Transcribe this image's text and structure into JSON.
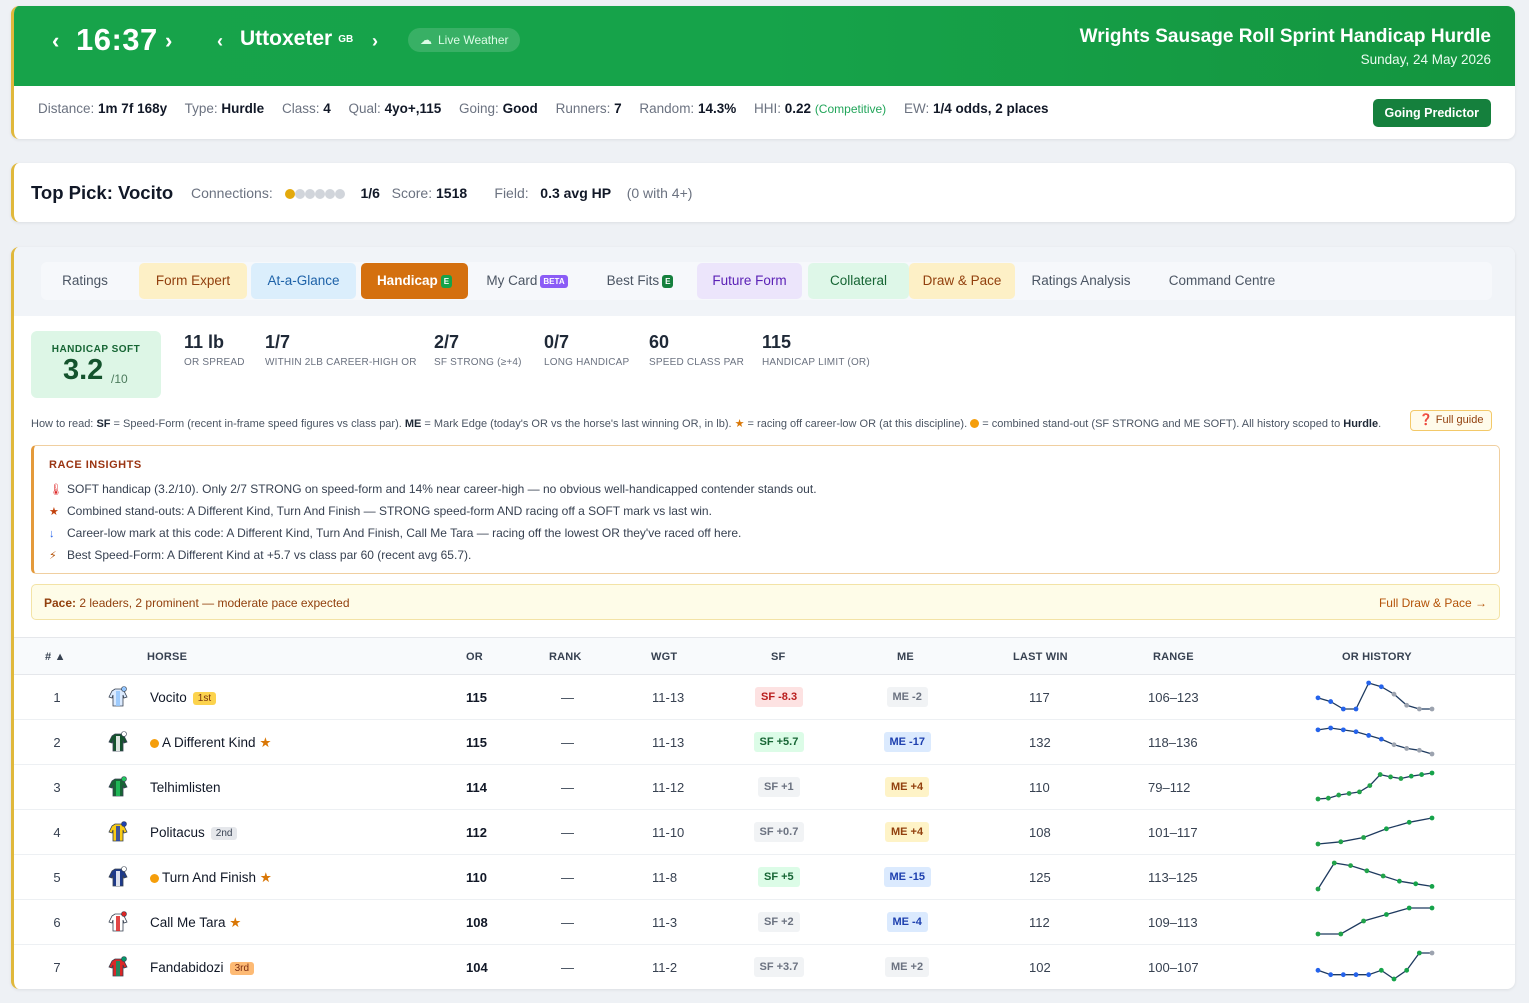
{
  "header": {
    "time": "16:37",
    "course": "Uttoxeter",
    "country": "GB",
    "live_weather": "Live Weather",
    "race_name": "Wrights Sausage Roll Sprint Handicap Hurdle",
    "date": "Sunday, 24 May 2026",
    "going_predictor": "Going Predictor",
    "facts": [
      {
        "label": "Distance:",
        "value": "1m 7f 168y"
      },
      {
        "label": "Type:",
        "value": "Hurdle"
      },
      {
        "label": "Class:",
        "value": "4"
      },
      {
        "label": "Qual:",
        "value": "4yo+,115"
      },
      {
        "label": "Going:",
        "value": "Good"
      },
      {
        "label": "Runners:",
        "value": "7"
      },
      {
        "label": "Random:",
        "value": "14.3%"
      },
      {
        "label": "HHI:",
        "value": "0.22",
        "note": "(Competitive)"
      },
      {
        "label": "EW:",
        "value": "1/4 odds, 2 places"
      }
    ]
  },
  "top_pick": {
    "title": "Top Pick: Vocito",
    "connections_label": "Connections:",
    "connections_filled": 1,
    "connections_total": 6,
    "connections_value": "1/6",
    "score_label": "Score:",
    "score_value": "1518",
    "field_label": "Field:",
    "field_value": "0.3 avg HP",
    "field_note": "(0 with 4+)"
  },
  "tabs": [
    {
      "label": "Ratings",
      "badge": "",
      "active": false,
      "bg": "transparent",
      "fg": "#4b5563"
    },
    {
      "label": "Form Expert",
      "badge": "",
      "active": false,
      "bg": "#fdf0c6",
      "fg": "#92400e"
    },
    {
      "label": "At-a-Glance",
      "badge": "",
      "active": false,
      "bg": "#dbeefc",
      "fg": "#1e62a8"
    },
    {
      "label": "Handicap",
      "badge": "E",
      "active": true,
      "bg": "#d4700f",
      "fg": "#ffffff"
    },
    {
      "label": "My Card",
      "badge": "BETA",
      "active": false,
      "bg": "transparent",
      "fg": "#4b5563"
    },
    {
      "label": "Best Fits",
      "badge": "E",
      "active": false,
      "bg": "transparent",
      "fg": "#4b5563"
    },
    {
      "label": "Future Form",
      "badge": "",
      "active": false,
      "bg": "#ece5fb",
      "fg": "#5b21b6"
    },
    {
      "label": "Collateral",
      "badge": "",
      "active": false,
      "bg": "#def7e8",
      "fg": "#166534"
    },
    {
      "label": "Draw & Pace",
      "badge": "",
      "active": false,
      "bg": "#fdf0c6",
      "fg": "#92400e"
    },
    {
      "label": "Ratings Analysis",
      "badge": "",
      "active": false,
      "bg": "transparent",
      "fg": "#4b5563"
    },
    {
      "label": "Command Centre",
      "badge": "",
      "active": false,
      "bg": "transparent",
      "fg": "#4b5563"
    }
  ],
  "summary": {
    "soft_label": "HANDICAP SOFT",
    "soft_value": "3.2",
    "soft_den": "/10",
    "stats": [
      {
        "value": "11 lb",
        "label": "OR SPREAD"
      },
      {
        "value": "1/7",
        "label": "WITHIN 2LB CAREER-HIGH OR"
      },
      {
        "value": "2/7",
        "label": "SF STRONG (≥+4)"
      },
      {
        "value": "0/7",
        "label": "LONG HANDICAP"
      },
      {
        "value": "60",
        "label": "SPEED CLASS PAR"
      },
      {
        "value": "115",
        "label": "HANDICAP LIMIT (OR)"
      }
    ]
  },
  "how_to_read": {
    "prefix": "How to read:",
    "sf_key": "SF",
    "sf_text": " = Speed-Form (recent in-frame speed figures vs class par). ",
    "me_key": "ME",
    "me_text": " = Mark Edge (today's OR vs the horse's last winning OR, in lb). ",
    "star_text": " = racing off career-low OR (at this discipline). ",
    "dot_text": " = combined stand-out (SF STRONG and ME SOFT). All history scoped to ",
    "scope": "Hurdle",
    "scope_end": ".",
    "full_guide": "Full guide"
  },
  "insights": {
    "title": "RACE INSIGHTS",
    "lines": [
      {
        "icon": "🌡",
        "text": "SOFT handicap (3.2/10). Only 2/7 STRONG on speed-form and 14% near career-high — no obvious well-handicapped contender stands out."
      },
      {
        "icon": "★",
        "text": "Combined stand-outs: A Different Kind, Turn And Finish — STRONG speed-form AND racing off a SOFT mark vs last win."
      },
      {
        "icon": "↓",
        "text": "Career-low mark at this code: A Different Kind, Turn And Finish, Call Me Tara — racing off the lowest OR they've raced off here."
      },
      {
        "icon": "⚡",
        "text": "Best Speed-Form: A Different Kind at +5.7 vs class par 60 (recent avg 65.7)."
      }
    ]
  },
  "pace": {
    "label": "Pace:",
    "text": "2 leaders, 2 prominent — moderate pace expected",
    "link": "Full Draw & Pace →"
  },
  "table": {
    "headers": [
      "# ▲",
      "HORSE",
      "OR",
      "RANK",
      "WGT",
      "SF",
      "ME",
      "LAST WIN",
      "RANGE",
      "OR HISTORY"
    ],
    "rows": [
      {
        "num": "1",
        "horse": "Vocito",
        "standout": false,
        "career_low": false,
        "pos": "1st",
        "or": "115",
        "rank": "—",
        "wgt": "11-13",
        "sf": "SF -8.3",
        "sf_kind": "neg",
        "me": "ME -2",
        "me_kind": "neutral",
        "last_win": "117",
        "range": "106–123",
        "silk": [
          "#dbeafe",
          "#93c5fd"
        ],
        "history": [
          112,
          111,
          109,
          109,
          116,
          115,
          113,
          110,
          109,
          109
        ]
      },
      {
        "num": "2",
        "horse": "A Different Kind",
        "standout": true,
        "career_low": true,
        "pos": "",
        "or": "115",
        "rank": "—",
        "wgt": "11-13",
        "sf": "SF +5.7",
        "sf_kind": "pos",
        "me": "ME -17",
        "me_kind": "blue",
        "last_win": "132",
        "range": "118–136",
        "silk": [
          "#14532d",
          "#ffffff"
        ],
        "history": [
          132,
          133,
          132,
          131,
          129,
          127,
          124,
          122,
          121,
          119
        ]
      },
      {
        "num": "3",
        "horse": "Telhimlisten",
        "standout": false,
        "career_low": false,
        "pos": "",
        "or": "114",
        "rank": "—",
        "wgt": "11-12",
        "sf": "SF +1",
        "sf_kind": "neutral",
        "me": "ME +4",
        "me_kind": "amber",
        "last_win": "110",
        "range": "79–112",
        "silk": [
          "#166534",
          "#22c55e"
        ],
        "history": [
          79,
          80,
          84,
          86,
          88,
          96,
          110,
          107,
          105,
          108,
          110,
          112
        ]
      },
      {
        "num": "4",
        "horse": "Politacus",
        "standout": false,
        "career_low": false,
        "pos": "2nd",
        "or": "112",
        "rank": "—",
        "wgt": "11-10",
        "sf": "SF +0.7",
        "sf_kind": "neutral",
        "me": "ME +4",
        "me_kind": "amber",
        "last_win": "108",
        "range": "101–117",
        "silk": [
          "#facc15",
          "#1e40af"
        ],
        "history": [
          101,
          102,
          104,
          108,
          111,
          113
        ]
      },
      {
        "num": "5",
        "horse": "Turn And Finish",
        "standout": true,
        "career_low": true,
        "pos": "",
        "or": "110",
        "rank": "—",
        "wgt": "11-8",
        "sf": "SF +5",
        "sf_kind": "pos",
        "me": "ME -15",
        "me_kind": "blue",
        "last_win": "125",
        "range": "113–125",
        "silk": [
          "#1e3a8a",
          "#ffffff"
        ],
        "history": [
          114,
          124,
          123,
          121,
          119,
          117,
          116,
          115
        ]
      },
      {
        "num": "6",
        "horse": "Call Me Tara",
        "standout": false,
        "career_low": true,
        "pos": "",
        "or": "108",
        "rank": "—",
        "wgt": "11-3",
        "sf": "SF +2",
        "sf_kind": "neutral",
        "me": "ME -4",
        "me_kind": "blue",
        "last_win": "112",
        "range": "109–113",
        "silk": [
          "#ffffff",
          "#dc2626"
        ],
        "history": [
          109,
          109,
          111,
          112,
          113,
          113
        ]
      },
      {
        "num": "7",
        "horse": "Fandabidozi",
        "standout": false,
        "career_low": false,
        "pos": "3rd",
        "or": "104",
        "rank": "—",
        "wgt": "11-2",
        "sf": "SF +3.7",
        "sf_kind": "neutral",
        "me": "ME +2",
        "me_kind": "neutral",
        "last_win": "102",
        "range": "100–107",
        "silk": [
          "#dc2626",
          "#059669"
        ],
        "history": [
          102,
          101,
          101,
          101,
          101,
          102,
          100,
          102,
          106,
          106
        ]
      }
    ]
  },
  "colors": {
    "header_green": "#16a34a",
    "accent_gold": "#e0b83c",
    "handicap_tab": "#d4700f",
    "sf_positive_bg": "#dcfce7",
    "sf_negative_bg": "#fde2e2",
    "me_blue_bg": "#dbeafe",
    "me_amber_bg": "#fef3c7"
  }
}
